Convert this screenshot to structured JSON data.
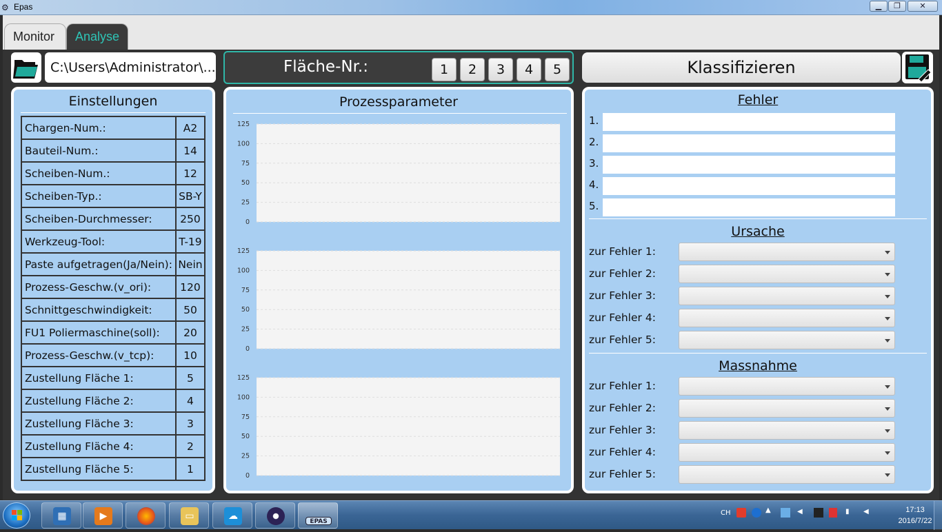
{
  "window": {
    "title": "Epas",
    "minimize": "▁",
    "maximize": "❐",
    "close": "✕"
  },
  "tabs": [
    {
      "label": "Monitor",
      "active": false
    },
    {
      "label": "Analyse",
      "active": true
    }
  ],
  "toolbar": {
    "path_value": "C:\\Users\\Administrator\\...",
    "flaeche_label": "Fläche-Nr.:",
    "flaeche_buttons": [
      "1",
      "2",
      "3",
      "4",
      "5"
    ],
    "classify_label": "Klassifizieren",
    "folder_icon": "folder-open-icon",
    "save_icon": "save-icon"
  },
  "settings": {
    "title": "Einstellungen",
    "rows": [
      {
        "label": "Chargen-Num.:",
        "value": "A2"
      },
      {
        "label": "Bauteil-Num.:",
        "value": "14"
      },
      {
        "label": "Scheiben-Num.:",
        "value": "12"
      },
      {
        "label": "Scheiben-Typ.:",
        "value": "SB-Y"
      },
      {
        "label": "Scheiben-Durchmesser:",
        "value": "250"
      },
      {
        "label": "Werkzeug-Tool:",
        "value": "T-19"
      },
      {
        "label": "Paste aufgetragen(Ja/Nein):",
        "value": "Nein"
      },
      {
        "label": "Prozess-Geschw.(v_ori):",
        "value": "120"
      },
      {
        "label": "Schnittgeschwindigkeit:",
        "value": "50"
      },
      {
        "label": "FU1 Poliermaschine(soll):",
        "value": "20"
      },
      {
        "label": "Prozess-Geschw.(v_tcp):",
        "value": "10"
      },
      {
        "label": "Zustellung Fläche 1:",
        "value": "5"
      },
      {
        "label": "Zustellung Fläche 2:",
        "value": "4"
      },
      {
        "label": "Zustellung Fläche 3:",
        "value": "3"
      },
      {
        "label": "Zustellung Fläche 4:",
        "value": "2"
      },
      {
        "label": "Zustellung Fläche 5:",
        "value": "1"
      }
    ]
  },
  "process": {
    "title": "Prozessparameter"
  },
  "chart_data": [
    {
      "type": "line",
      "title": "",
      "xlabel": "",
      "ylabel": "",
      "ylim": [
        0,
        125
      ],
      "yticks": [
        "0",
        "25",
        "50",
        "75",
        "100",
        "125"
      ],
      "series": [],
      "grid": true
    },
    {
      "type": "line",
      "title": "",
      "xlabel": "",
      "ylabel": "",
      "ylim": [
        0,
        125
      ],
      "yticks": [
        "0",
        "25",
        "50",
        "75",
        "100",
        "125"
      ],
      "series": [],
      "grid": true
    },
    {
      "type": "line",
      "title": "",
      "xlabel": "",
      "ylabel": "",
      "ylim": [
        0,
        125
      ],
      "yticks": [
        "0",
        "25",
        "50",
        "75",
        "100",
        "125"
      ],
      "series": [],
      "grid": true
    }
  ],
  "fehler": {
    "title": "Fehler",
    "items": [
      {
        "num": "1.",
        "value": ""
      },
      {
        "num": "2.",
        "value": ""
      },
      {
        "num": "3.",
        "value": ""
      },
      {
        "num": "4.",
        "value": ""
      },
      {
        "num": "5.",
        "value": ""
      }
    ]
  },
  "ursache": {
    "title": "Ursache",
    "items": [
      "zur Fehler 1:",
      "zur Fehler 2:",
      "zur Fehler 3:",
      "zur Fehler 4:",
      "zur Fehler 5:"
    ]
  },
  "massnahme": {
    "title": "Massnahme",
    "items": [
      "zur Fehler 1:",
      "zur Fehler 2:",
      "zur Fehler 3:",
      "zur Fehler 4:",
      "zur Fehler 5:"
    ]
  },
  "taskbar": {
    "apps": [
      "file-explorer-library-icon",
      "media-player-icon",
      "firefox-icon",
      "folder-icon",
      "network-app-icon",
      "eclipse-icon",
      "epas-app-icon"
    ],
    "epas_label": "EPAS",
    "lang": "CH",
    "time": "17:13",
    "date": "2016/7/22"
  }
}
